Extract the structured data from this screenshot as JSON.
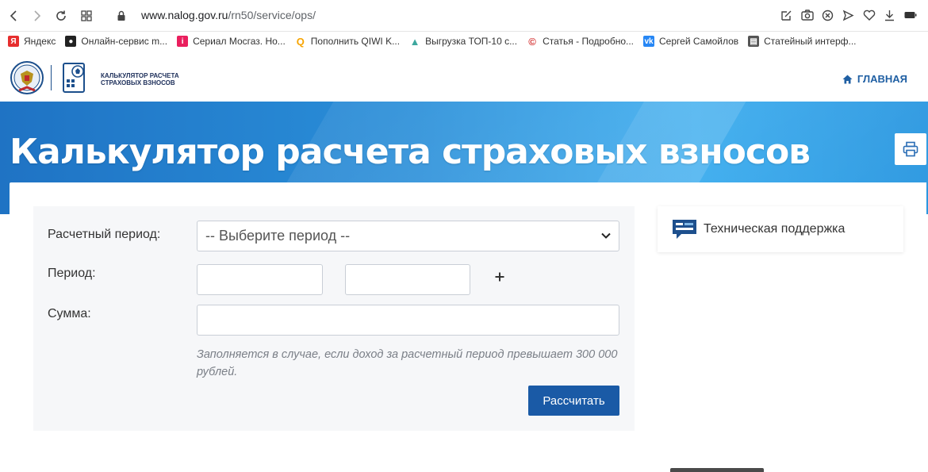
{
  "browser": {
    "url_domain": "www.nalog.gov.ru",
    "url_path": "/rn50/service/ops/",
    "bookmarks": [
      {
        "label": "Яндекс",
        "icon": "yandex-icon",
        "color": "#e62e2e"
      },
      {
        "label": "Онлайн-сервис m...",
        "icon": "bookmark-dark-icon",
        "color": "#222222"
      },
      {
        "label": "Сериал Мосгаз. Но...",
        "icon": "ivi-icon",
        "color": "#ea1f5e"
      },
      {
        "label": "Пополнить QIWI K...",
        "icon": "qiwi-icon",
        "color": "#f7a400"
      },
      {
        "label": "Выгрузка ТОП-10 с...",
        "icon": "triangle-icon",
        "color": "#3da79e"
      },
      {
        "label": "Статья - Подробно...",
        "icon": "copyright-icon",
        "color": "#d32f2f"
      },
      {
        "label": "Сергей Самойлов",
        "icon": "vk-icon",
        "color": "#2787f5"
      },
      {
        "label": "Статейный интерф...",
        "icon": "document-icon",
        "color": "#555555"
      }
    ]
  },
  "header": {
    "brand_line1": "КАЛЬКУЛЯТОР РАСЧЕТА",
    "brand_line2": "СТРАХОВЫХ ВЗНОСОВ",
    "home_label": "ГЛАВНАЯ"
  },
  "banner": {
    "title": "Калькулятор расчета страховых взносов"
  },
  "form": {
    "period_label": "Расчетный период:",
    "period_select_value": "-- Выберите период --",
    "range_label": "Период:",
    "range_from": "",
    "range_to": "",
    "sum_label": "Сумма:",
    "sum_value": "",
    "hint": "Заполняется в случае, если доход за расчетный период превышает 300 000 рублей.",
    "submit_label": "Рассчитать"
  },
  "support": {
    "label": "Техническая поддержка"
  },
  "colors": {
    "accent": "#1a5aa6",
    "banner_start": "#1f73c4",
    "banner_end": "#36aaee"
  }
}
